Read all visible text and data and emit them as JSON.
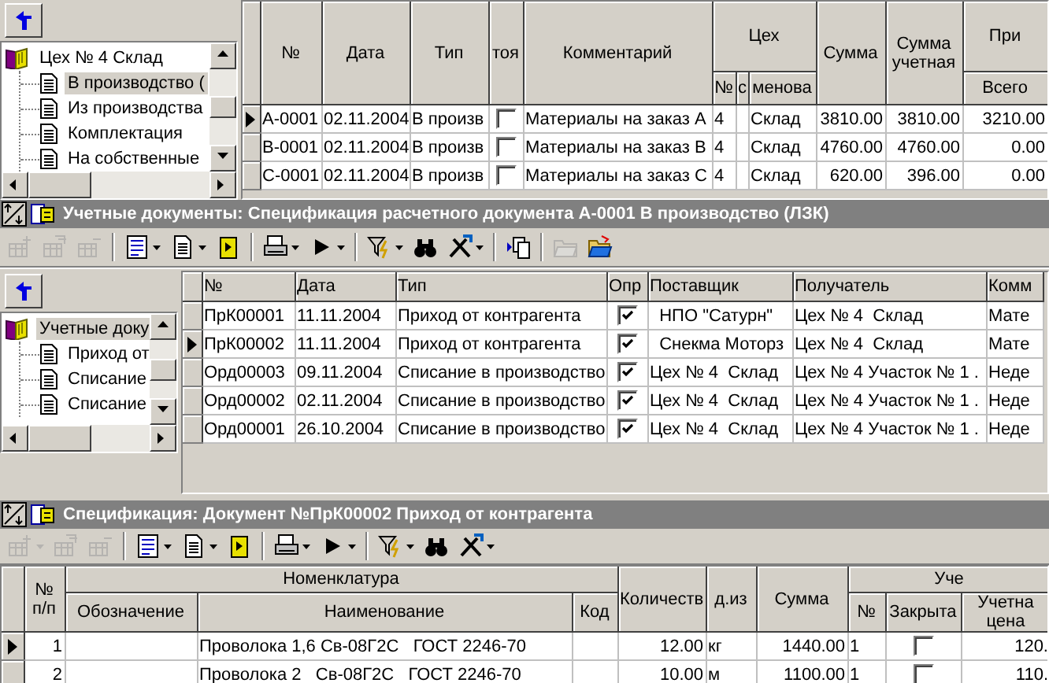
{
  "top": {
    "tree": [
      {
        "label": "Цех № 4 Склад",
        "selected": false,
        "children": [
          {
            "label": "В производство (",
            "selected": true
          },
          {
            "label": "Из производства",
            "selected": false
          },
          {
            "label": "Комплектация",
            "selected": false
          },
          {
            "label": "На собственные",
            "selected": false
          }
        ]
      }
    ],
    "grid": {
      "columns": [
        {
          "label": "№",
          "kind": "text"
        },
        {
          "label": "Дата",
          "kind": "text"
        },
        {
          "label": "Тип",
          "kind": "text"
        },
        {
          "label": "тоя",
          "kind": "checkbox"
        },
        {
          "label": "Комментарий",
          "kind": "text"
        },
        {
          "label": "Цех",
          "colspan": 3,
          "children": [
            {
              "label": "№",
              "kind": "text"
            },
            {
              "label": "с",
              "kind": "text"
            },
            {
              "label": "менова",
              "kind": "text"
            }
          ]
        },
        {
          "label": "Сумма",
          "kind": "number"
        },
        {
          "label": "Сумма учетная",
          "kind": "number"
        },
        {
          "label": "При",
          "children": [
            {
              "label": "Всего",
              "kind": "number"
            }
          ]
        }
      ],
      "rows": [
        {
          "selected": true,
          "cells": [
            "A-0001",
            "02.11.2004",
            "В произв",
            false,
            "Материалы на заказ A",
            "4",
            null,
            "Склад",
            "3810.00",
            "3810.00",
            "3210.00"
          ]
        },
        {
          "selected": false,
          "cells": [
            "B-0001",
            "02.11.2004",
            "В произв",
            false,
            "Материалы на заказ B",
            "4",
            null,
            "Склад",
            "4760.00",
            "4760.00",
            "0.00"
          ]
        },
        {
          "selected": false,
          "cells": [
            "C-0001",
            "02.11.2004",
            "В произв",
            false,
            "Материалы на заказ C",
            "4",
            null,
            "Склад",
            "620.00",
            "396.00",
            "0.00"
          ]
        }
      ]
    }
  },
  "documents": {
    "title": "Учетные документы: Спецификация расчетного документа А-0001 В производство (ЛЗК)",
    "toolbar": [
      {
        "kind": "add",
        "disabled": true,
        "dropdown": false
      },
      {
        "kind": "copy",
        "disabled": true,
        "dropdown": false
      },
      {
        "kind": "remove",
        "disabled": true,
        "dropdown": false
      },
      {
        "kind": "separator"
      },
      {
        "kind": "list",
        "disabled": false,
        "dropdown": true
      },
      {
        "kind": "document",
        "disabled": false,
        "dropdown": true
      },
      {
        "kind": "export",
        "disabled": false,
        "dropdown": false
      },
      {
        "kind": "separator"
      },
      {
        "kind": "print",
        "disabled": false,
        "dropdown": true
      },
      {
        "kind": "run",
        "disabled": false,
        "dropdown": true
      },
      {
        "kind": "separator"
      },
      {
        "kind": "filter",
        "disabled": false,
        "dropdown": true
      },
      {
        "kind": "find",
        "disabled": false,
        "dropdown": false
      },
      {
        "kind": "tools",
        "disabled": false,
        "dropdown": true
      },
      {
        "kind": "separator"
      },
      {
        "kind": "copy_rows",
        "disabled": false,
        "dropdown": false
      },
      {
        "kind": "separator"
      },
      {
        "kind": "folder",
        "disabled": true,
        "dropdown": false
      },
      {
        "kind": "open",
        "disabled": false,
        "dropdown": false
      }
    ],
    "tree": [
      {
        "label": "Учетные доку",
        "selected": true,
        "children": [
          {
            "label": "Приход от",
            "selected": false
          },
          {
            "label": "Списание",
            "selected": false
          },
          {
            "label": "Списание",
            "selected": false
          }
        ]
      }
    ],
    "grid": {
      "columns": [
        {
          "label": "№",
          "kind": "text"
        },
        {
          "label": "Дата",
          "kind": "text"
        },
        {
          "label": "Тип",
          "kind": "text"
        },
        {
          "label": "Опр",
          "kind": "checkbox"
        },
        {
          "label": "Поставщик",
          "kind": "text"
        },
        {
          "label": "Получатель",
          "kind": "text"
        },
        {
          "label": "Комм",
          "kind": "text"
        }
      ],
      "rows": [
        {
          "selected": false,
          "cells": [
            "ПрК00001",
            "11.11.2004",
            "Приход от контрагента",
            true,
            "  НПО \"Сатурн\"",
            "Цех № 4  Склад",
            "Мате"
          ]
        },
        {
          "selected": true,
          "cells": [
            "ПрК00002",
            "11.11.2004",
            "Приход от контрагента",
            true,
            "  Снекма Моторз",
            "Цех № 4  Склад",
            "Мате"
          ]
        },
        {
          "selected": false,
          "cells": [
            "Орд00003",
            "09.11.2004",
            "Списание в производство",
            true,
            "Цех № 4  Склад",
            "Цех № 4 Участок № 1 .",
            "Неде"
          ]
        },
        {
          "selected": false,
          "cells": [
            "Орд00002",
            "02.11.2004",
            "Списание в производство",
            true,
            "Цех № 4  Склад",
            "Цех № 4 Участок № 1 .",
            "Неде"
          ]
        },
        {
          "selected": false,
          "cells": [
            "Орд00001",
            "26.10.2004",
            "Списание в производство",
            true,
            "Цех № 4  Склад",
            "Цех № 4 Участок № 1 .",
            "Неде"
          ]
        }
      ]
    }
  },
  "specification": {
    "title": "Спецификация: Документ №ПрК00002 Приход от контрагента",
    "toolbar": [
      {
        "kind": "add",
        "disabled": true,
        "dropdown": true
      },
      {
        "kind": "copy",
        "disabled": true,
        "dropdown": false
      },
      {
        "kind": "remove",
        "disabled": true,
        "dropdown": false
      },
      {
        "kind": "separator"
      },
      {
        "kind": "list",
        "disabled": false,
        "dropdown": true
      },
      {
        "kind": "document",
        "disabled": false,
        "dropdown": true
      },
      {
        "kind": "export",
        "disabled": false,
        "dropdown": false
      },
      {
        "kind": "separator"
      },
      {
        "kind": "print",
        "disabled": false,
        "dropdown": true
      },
      {
        "kind": "run",
        "disabled": false,
        "dropdown": true
      },
      {
        "kind": "separator"
      },
      {
        "kind": "filter",
        "disabled": false,
        "dropdown": true
      },
      {
        "kind": "find",
        "disabled": false,
        "dropdown": false
      },
      {
        "kind": "tools",
        "disabled": false,
        "dropdown": true
      }
    ],
    "grid": {
      "columns": [
        {
          "label": "№ п/п",
          "kind": "number"
        },
        {
          "label": "Номенклатура",
          "colspan": 3,
          "children": [
            {
              "label": "Обозначение",
              "kind": "text"
            },
            {
              "label": "Наименование",
              "kind": "text"
            },
            {
              "label": "Код",
              "kind": "text"
            }
          ]
        },
        {
          "label": "Количеств",
          "kind": "number"
        },
        {
          "label": "д.из",
          "kind": "text"
        },
        {
          "label": "Сумма",
          "kind": "number"
        },
        {
          "label": "Уче",
          "colspan": 3,
          "children": [
            {
              "label": "№",
              "kind": "text"
            },
            {
              "label": "Закрыта",
              "kind": "checkbox"
            },
            {
              "label": "Учетна цена",
              "kind": "number"
            }
          ]
        }
      ],
      "rows": [
        {
          "selected": true,
          "cells": [
            "1",
            null,
            "Проволока 1,6 Св-08Г2С   ГОСТ 2246-70",
            null,
            "12.00",
            "кг",
            "1440.00",
            "1",
            false,
            "120."
          ]
        },
        {
          "selected": false,
          "cells": [
            "2",
            null,
            "Проволока 2   Св-08Г2С   ГОСТ 2246-70",
            null,
            "10.00",
            "м",
            "1100.00",
            "1",
            false,
            "110."
          ]
        }
      ]
    }
  }
}
